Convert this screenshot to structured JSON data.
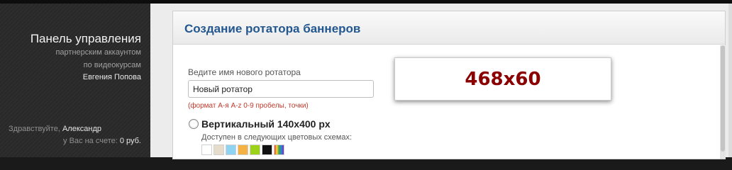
{
  "sidebar": {
    "title": "Панель управления",
    "subtitle_line1": "партнерским аккаунтом",
    "subtitle_line2": "по видеокурсам",
    "owner": "Евгения Попова",
    "greeting": "Здравствуйте,",
    "user_name": "Александр",
    "balance_label": "у Вас на счете:",
    "balance_value": "0 руб."
  },
  "panel": {
    "title": "Создание ротатора баннеров"
  },
  "form": {
    "name_label": "Ведите имя нового ротатора",
    "name_value": "Новый ротатор",
    "format_hint": "(формат А-я A-z 0-9 пробелы, точки)",
    "option_vertical_label": "Вертикальный 140x400 px",
    "schemes_label": "Доступен в следующих цветовых схемах:"
  },
  "banner": {
    "size_text": "468x60"
  },
  "colors": {
    "accent": "#23578f",
    "banner_text": "#8b0000",
    "hint": "#c0392b",
    "swatches": [
      "#ffffff",
      "#e6dccb",
      "#8fd3f2",
      "#f4b144",
      "#9dd21a",
      "#111111",
      "rainbow"
    ]
  }
}
